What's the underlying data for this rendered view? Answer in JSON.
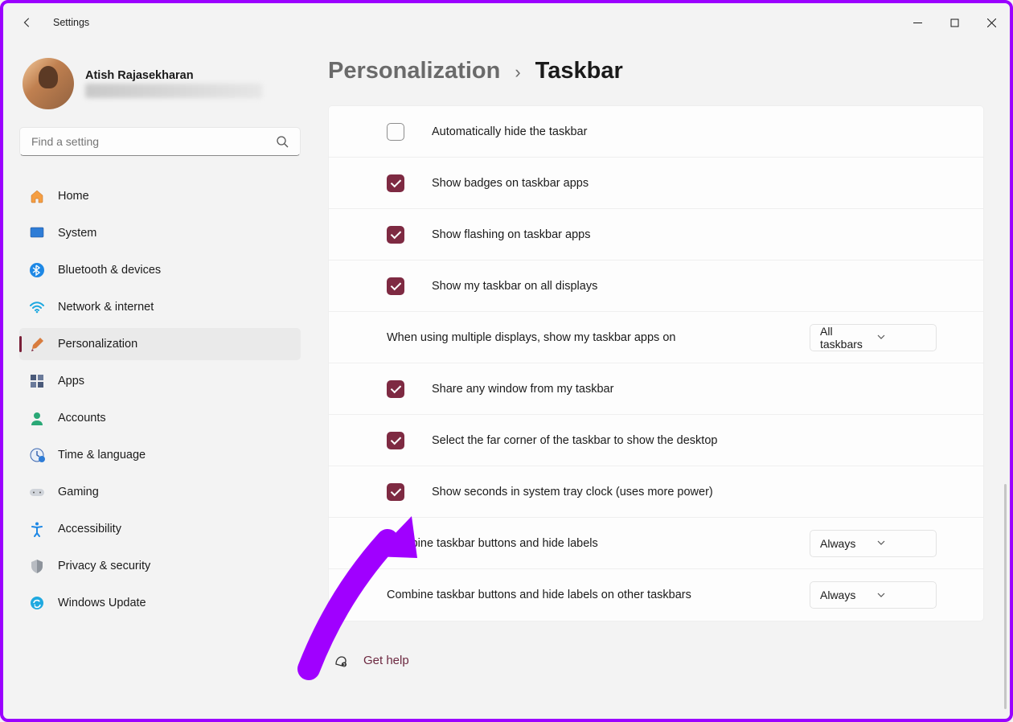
{
  "window": {
    "title": "Settings"
  },
  "user": {
    "name": "Atish Rajasekharan"
  },
  "search": {
    "placeholder": "Find a setting"
  },
  "nav": [
    {
      "label": "Home",
      "icon": "home",
      "selected": false
    },
    {
      "label": "System",
      "icon": "system",
      "selected": false
    },
    {
      "label": "Bluetooth & devices",
      "icon": "bt",
      "selected": false
    },
    {
      "label": "Network & internet",
      "icon": "wifi",
      "selected": false
    },
    {
      "label": "Personalization",
      "icon": "brush",
      "selected": true
    },
    {
      "label": "Apps",
      "icon": "apps",
      "selected": false
    },
    {
      "label": "Accounts",
      "icon": "account",
      "selected": false
    },
    {
      "label": "Time & language",
      "icon": "clock",
      "selected": false
    },
    {
      "label": "Gaming",
      "icon": "gaming",
      "selected": false
    },
    {
      "label": "Accessibility",
      "icon": "access",
      "selected": false
    },
    {
      "label": "Privacy & security",
      "icon": "shield",
      "selected": false
    },
    {
      "label": "Windows Update",
      "icon": "update",
      "selected": false
    }
  ],
  "breadcrumb": {
    "parent": "Personalization",
    "current": "Taskbar"
  },
  "rows": [
    {
      "type": "checkbox",
      "checked": false,
      "label": "Automatically hide the taskbar"
    },
    {
      "type": "checkbox",
      "checked": true,
      "label": "Show badges on taskbar apps"
    },
    {
      "type": "checkbox",
      "checked": true,
      "label": "Show flashing on taskbar apps"
    },
    {
      "type": "checkbox",
      "checked": true,
      "label": "Show my taskbar on all displays"
    },
    {
      "type": "select",
      "label": "When using multiple displays, show my taskbar apps on",
      "value": "All taskbars"
    },
    {
      "type": "checkbox",
      "checked": true,
      "label": "Share any window from my taskbar"
    },
    {
      "type": "checkbox",
      "checked": true,
      "label": "Select the far corner of the taskbar to show the desktop"
    },
    {
      "type": "checkbox",
      "checked": true,
      "label": "Show seconds in system tray clock (uses more power)"
    },
    {
      "type": "select",
      "label": "Combine taskbar buttons and hide labels",
      "value": "Always"
    },
    {
      "type": "select",
      "label": "Combine taskbar buttons and hide labels on other taskbars",
      "value": "Always"
    }
  ],
  "help": {
    "label": "Get help"
  },
  "colors": {
    "accent": "#7e2a42",
    "annotation": "#a000ff"
  }
}
